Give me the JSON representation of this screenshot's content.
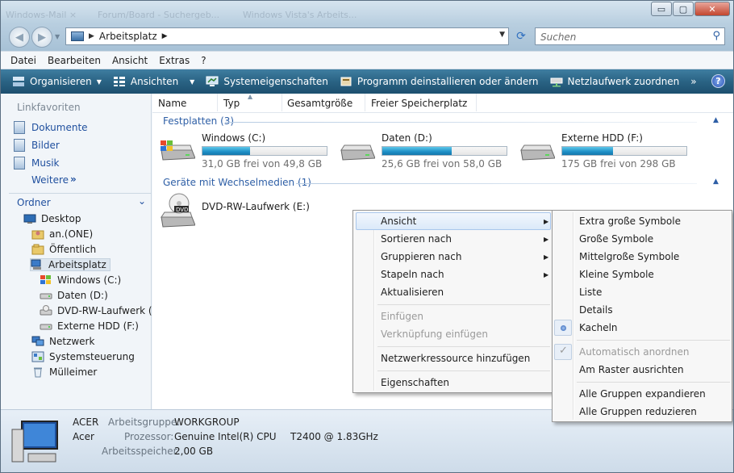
{
  "window": {
    "ghost_tabs": [
      "Windows-Mail ×",
      "Forum/Board - Suchergeb...",
      "Windows Vista's Arbeits..."
    ]
  },
  "title_controls": {
    "minimize": "▭",
    "maximize": "▢",
    "close": "✕"
  },
  "navigation": {
    "address": "Arbeitsplatz",
    "search_placeholder": "Suchen"
  },
  "menubar": [
    "Datei",
    "Bearbeiten",
    "Ansicht",
    "Extras",
    "?"
  ],
  "toolbar": {
    "organize": "Organisieren",
    "views": "Ansichten",
    "system_properties": "Systemeigenschaften",
    "uninstall": "Programm deinstallieren oder ändern",
    "map_drive": "Netzlaufwerk zuordnen",
    "more": "»"
  },
  "sidebar": {
    "favorites_title": "Linkfavoriten",
    "favorites": [
      "Dokumente",
      "Bilder",
      "Musik"
    ],
    "more": "Weitere",
    "more_chevron": "»",
    "folders_title": "Ordner",
    "tree": [
      {
        "label": "Desktop",
        "icon": "desktop-icon"
      },
      {
        "label": "an.(ONE)",
        "icon": "user-folder-icon"
      },
      {
        "label": "Öffentlich",
        "icon": "folder-icon"
      },
      {
        "label": "Arbeitsplatz",
        "icon": "computer-icon"
      },
      {
        "label": "Windows (C:)",
        "icon": "windows-drive-icon"
      },
      {
        "label": "Daten (D:)",
        "icon": "drive-icon"
      },
      {
        "label": "DVD-RW-Laufwerk (E:",
        "icon": "dvd-icon"
      },
      {
        "label": "Externe HDD (F:)",
        "icon": "drive-icon"
      },
      {
        "label": "Netzwerk",
        "icon": "network-icon"
      },
      {
        "label": "Systemsteuerung",
        "icon": "control-panel-icon"
      },
      {
        "label": "Mülleimer",
        "icon": "recycle-bin-icon"
      }
    ]
  },
  "columns": [
    "Name",
    "Typ",
    "Gesamtgröße",
    "Freier Speicherplatz"
  ],
  "groups": {
    "hard_disks": "Festplatten (3)",
    "removable": "Geräte mit Wechselmedien (1)"
  },
  "drives": [
    {
      "name": "Windows (C:)",
      "free_text": "31,0 GB frei von 49,8 GB",
      "used_fraction": 0.38
    },
    {
      "name": "Daten (D:)",
      "free_text": "25,6 GB frei von 58,0 GB",
      "used_fraction": 0.56
    },
    {
      "name": "Externe HDD (F:)",
      "free_text": "175 GB frei von 298 GB",
      "used_fraction": 0.41
    }
  ],
  "dvd": {
    "name": "DVD-RW-Laufwerk (E:)",
    "icon_text": "DVD"
  },
  "context_menu": {
    "items": [
      {
        "label": "Ansicht",
        "submenu": true,
        "highlighted": true
      },
      {
        "label": "Sortieren nach",
        "submenu": true
      },
      {
        "label": "Gruppieren nach",
        "submenu": true
      },
      {
        "label": "Stapeln nach",
        "submenu": true
      },
      {
        "label": "Aktualisieren"
      },
      {
        "label": "Einfügen",
        "disabled": true
      },
      {
        "label": "Verknüpfung einfügen",
        "disabled": true
      },
      {
        "label": "Netzwerkressource hinzufügen"
      },
      {
        "label": "Eigenschaften"
      }
    ]
  },
  "view_submenu": {
    "items": [
      {
        "label": "Extra große Symbole"
      },
      {
        "label": "Große Symbole"
      },
      {
        "label": "Mittelgroße Symbole"
      },
      {
        "label": "Kleine Symbole"
      },
      {
        "label": "Liste"
      },
      {
        "label": "Details"
      },
      {
        "label": "Kacheln",
        "selected": true
      },
      {
        "label": "Automatisch anordnen",
        "disabled": true,
        "checked": true
      },
      {
        "label": "Am Raster ausrichten"
      },
      {
        "label": "Alle Gruppen expandieren"
      },
      {
        "label": "Alle Gruppen reduzieren"
      }
    ]
  },
  "details_pane": {
    "computer_name": "ACER",
    "manufacturer": "Acer",
    "workgroup_label": "Arbeitsgruppe:",
    "workgroup_value": "WORKGROUP",
    "processor_label": "Prozessor:",
    "processor_value": "Genuine Intel(R) CPU",
    "processor_model": "T2400  @ 1.83GHz",
    "memory_label": "Arbeitsspeicher:",
    "memory_value": "2,00 GB"
  },
  "colors": {
    "command_bar": "#2a6384",
    "link": "#1f4f9e",
    "group_title": "#2e5fa6",
    "bar_fill": "#1e8fc6"
  }
}
